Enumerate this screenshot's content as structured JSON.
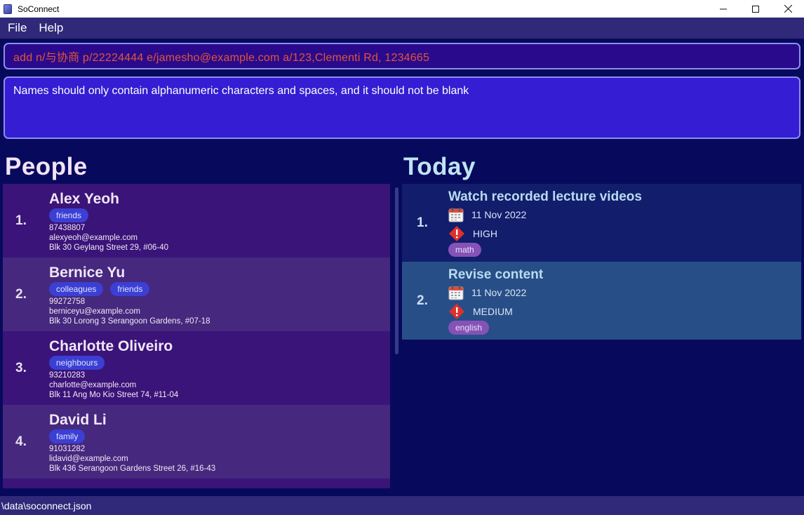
{
  "window": {
    "title": "SoConnect",
    "minimize_icon": "minimize-icon",
    "maximize_icon": "maximize-icon",
    "close_icon": "close-icon"
  },
  "menu": {
    "items": [
      {
        "label": "File"
      },
      {
        "label": "Help"
      }
    ]
  },
  "command": {
    "value": "add n/与协商 p/22224444 e/jamesho@example.com a/123,Clementi Rd, 1234665",
    "text_color": "#e0563a"
  },
  "result": {
    "text": "Names should only contain alphanumeric characters and spaces, and it should not be blank"
  },
  "people": {
    "heading": "People",
    "list": [
      {
        "index": "1.",
        "name": "Alex Yeoh",
        "tags": [
          "friends"
        ],
        "phone": "87438807",
        "email": "alexyeoh@example.com",
        "address": "Blk 30 Geylang Street 29, #06-40"
      },
      {
        "index": "2.",
        "name": "Bernice Yu",
        "tags": [
          "colleagues",
          "friends"
        ],
        "phone": "99272758",
        "email": "berniceyu@example.com",
        "address": "Blk 30 Lorong 3 Serangoon Gardens, #07-18"
      },
      {
        "index": "3.",
        "name": "Charlotte Oliveiro",
        "tags": [
          "neighbours"
        ],
        "phone": "93210283",
        "email": "charlotte@example.com",
        "address": "Blk 11 Ang Mo Kio Street 74, #11-04"
      },
      {
        "index": "4.",
        "name": "David Li",
        "tags": [
          "family"
        ],
        "phone": "91031282",
        "email": "lidavid@example.com",
        "address": "Blk 436 Serangoon Gardens Street 26, #16-43"
      }
    ]
  },
  "today": {
    "heading": "Today",
    "list": [
      {
        "index": "1.",
        "title": "Watch recorded lecture videos",
        "date": "11 Nov 2022",
        "priority": "HIGH",
        "tag": "math"
      },
      {
        "index": "2.",
        "title": "Revise content",
        "date": "11 Nov 2022",
        "priority": "MEDIUM",
        "tag": "english"
      }
    ]
  },
  "status": {
    "path": "\\data\\soconnect.json"
  },
  "colors": {
    "background": "#070a5c",
    "menu_bar": "#302878",
    "person_card_odd": "#3a1478",
    "person_card_even": "#46287e",
    "person_tag": "#3b3fd3",
    "task_card_first": "#121d6c",
    "task_card_second": "#284e87",
    "task_tag": "#8552b8",
    "priority_icon": "#e0302a"
  }
}
